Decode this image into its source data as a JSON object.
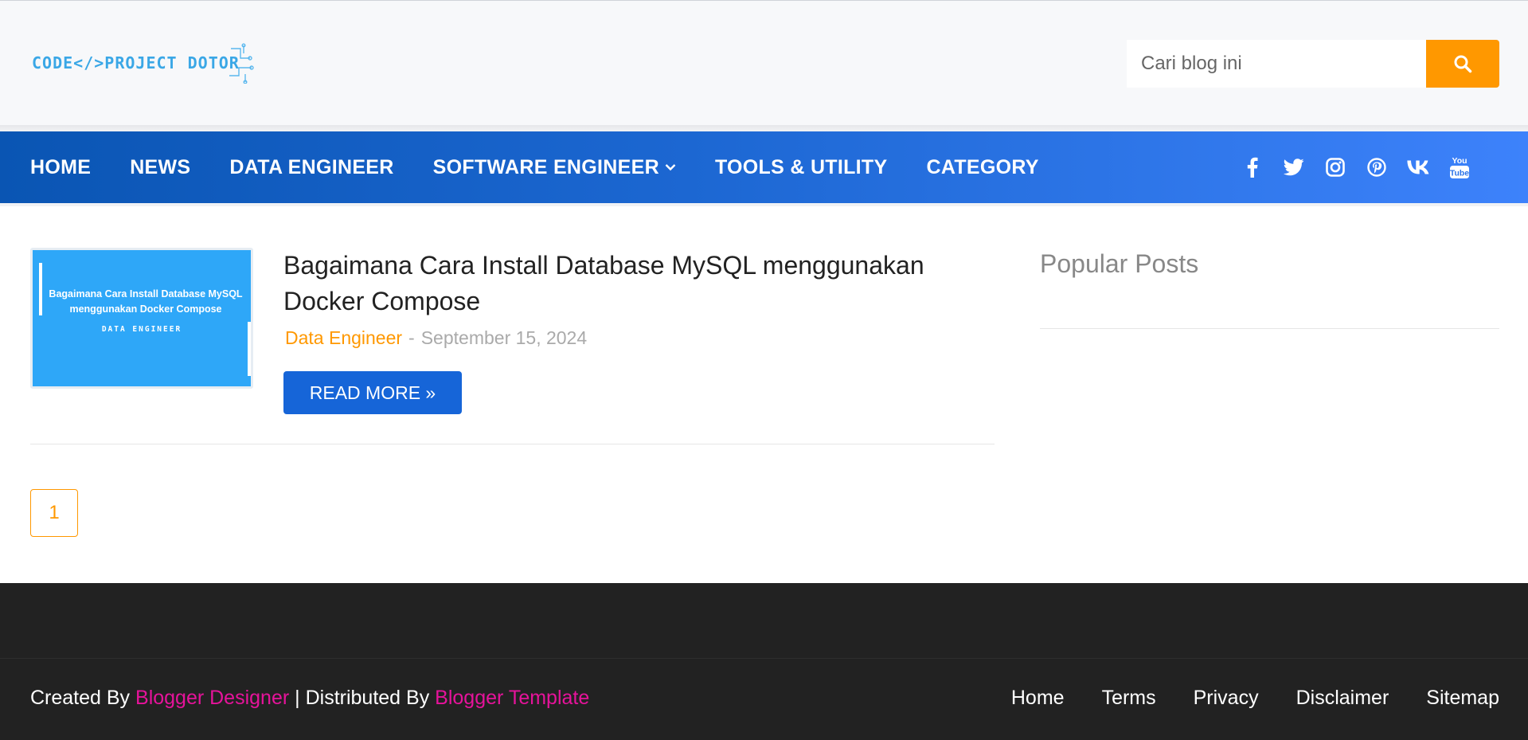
{
  "header": {
    "logo_text": "CODE</>PROJECT DOTOR",
    "search_placeholder": "Cari blog ini"
  },
  "nav": {
    "items": [
      {
        "label": "HOME"
      },
      {
        "label": "NEWS"
      },
      {
        "label": "DATA ENGINEER"
      },
      {
        "label": "SOFTWARE ENGINEER"
      },
      {
        "label": "TOOLS & UTILITY"
      },
      {
        "label": "CATEGORY"
      }
    ],
    "social": [
      "facebook-icon",
      "twitter-icon",
      "instagram-icon",
      "pinterest-icon",
      "vk-icon",
      "youtube-icon"
    ]
  },
  "post": {
    "thumb_title": "Bagaimana Cara Install Database MySQL menggunakan Docker Compose",
    "thumb_tag": "DATA ENGINEER",
    "title": "Bagaimana Cara Install Database MySQL menggunakan Docker Compose",
    "category": "Data Engineer",
    "separator": "-",
    "date": "September 15, 2024",
    "read_more": "READ MORE »"
  },
  "pagination": {
    "current": "1"
  },
  "sidebar": {
    "title": "Popular Posts"
  },
  "footer": {
    "created_by": "Created By",
    "designer": "Blogger Designer",
    "divider": "| Distributed By",
    "template": "Blogger Template",
    "links": [
      "Home",
      "Terms",
      "Privacy",
      "Disclaimer",
      "Sitemap"
    ]
  },
  "colors": {
    "accent": "#ff9800",
    "nav_start": "#0a55b3",
    "nav_end": "#3d82fb",
    "button": "#1665d8",
    "footer_bg": "#222222",
    "footer_link": "#e6139b"
  }
}
